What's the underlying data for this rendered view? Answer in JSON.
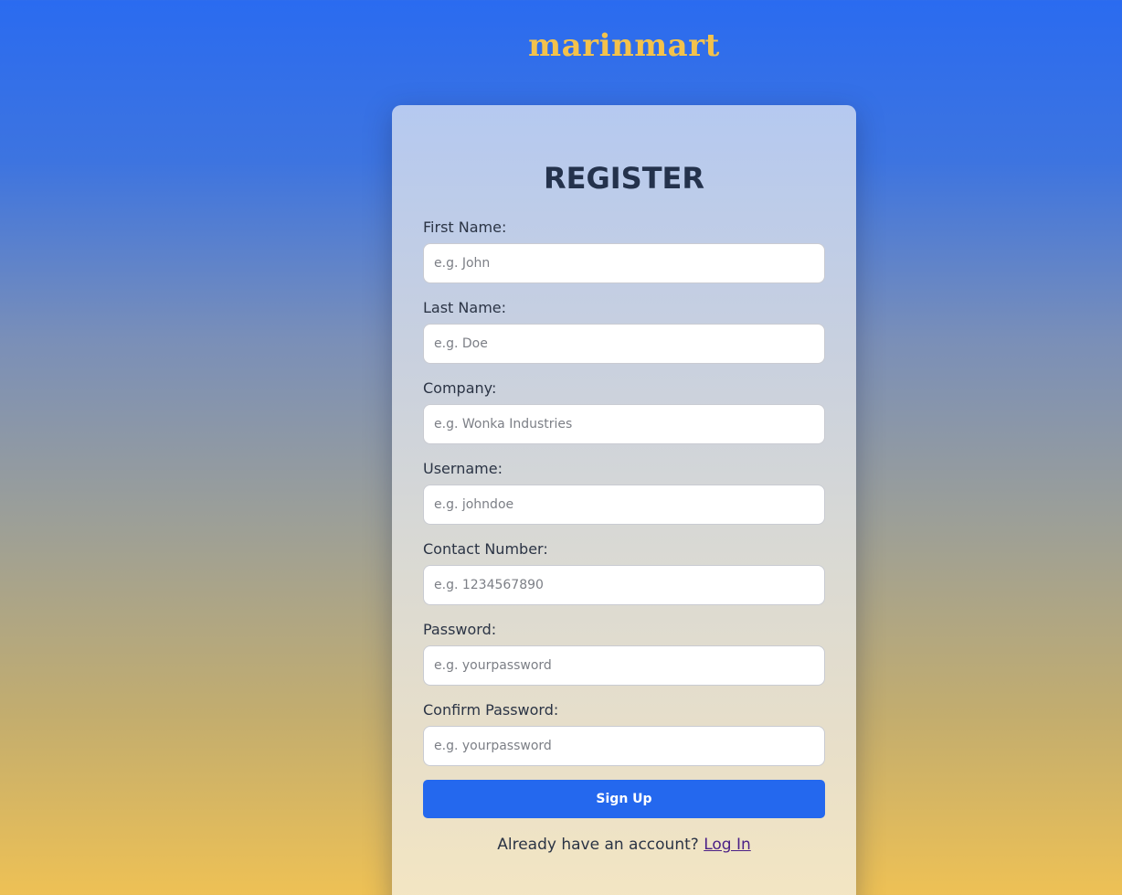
{
  "brand": {
    "name": "marinmart",
    "color": "#f3c24c"
  },
  "form": {
    "title": "REGISTER",
    "fields": [
      {
        "label": "First Name:",
        "placeholder": "e.g. John",
        "value": ""
      },
      {
        "label": "Last Name:",
        "placeholder": "e.g. Doe",
        "value": ""
      },
      {
        "label": "Company:",
        "placeholder": "e.g. Wonka Industries",
        "value": ""
      },
      {
        "label": "Username:",
        "placeholder": "e.g. johndoe",
        "value": ""
      },
      {
        "label": "Contact Number:",
        "placeholder": "e.g. 1234567890",
        "value": ""
      },
      {
        "label": "Password:",
        "placeholder": "e.g. yourpassword",
        "value": ""
      },
      {
        "label": "Confirm Password:",
        "placeholder": "e.g. yourpassword",
        "value": ""
      }
    ],
    "submit_label": "Sign Up",
    "login_prompt": "Already have an account?",
    "login_link": "Log In"
  },
  "colors": {
    "accent": "#2468ee",
    "title": "#24324c",
    "link": "#4a1f86"
  }
}
